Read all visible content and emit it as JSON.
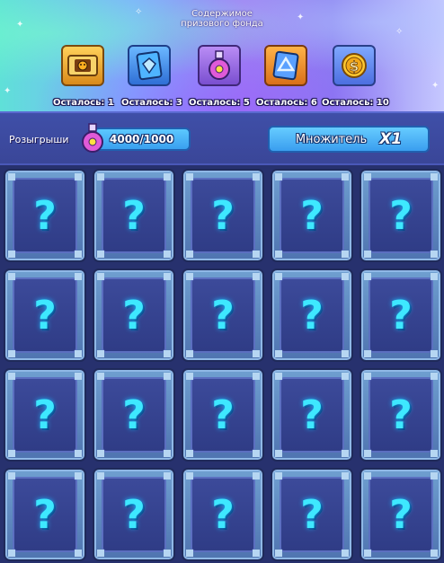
{
  "prize_pool": {
    "title_line1": "Содержимое",
    "title_line2": "призового фонда",
    "items": [
      {
        "icon": "gold-ticket-icon",
        "count_label": "Осталось: 1",
        "color": "#ffc24a"
      },
      {
        "icon": "blue-card-icon",
        "count_label": "Осталось: 3",
        "color": "#4f9bff"
      },
      {
        "icon": "potion-flask-icon",
        "count_label": "Осталось: 5",
        "color": "#c27cf2"
      },
      {
        "icon": "orange-card-icon",
        "count_label": "Осталось: 6",
        "color": "#ff9a30"
      },
      {
        "icon": "gold-coin-icon",
        "count_label": "Осталось: 10",
        "color": "#ffc030"
      }
    ]
  },
  "draws": {
    "label": "Розыгрыши",
    "value": "4000/1000",
    "icon": "potion-flask-icon"
  },
  "multiplier": {
    "label": "Множитель",
    "value": "X1"
  },
  "cards": {
    "rows": 4,
    "cols": 5,
    "face": "?",
    "icon": "question-mark-icon"
  },
  "colors": {
    "accent_cyan": "#3ee8ff",
    "button_blue": "#4ab2f5",
    "background": "#2d3a7a"
  }
}
